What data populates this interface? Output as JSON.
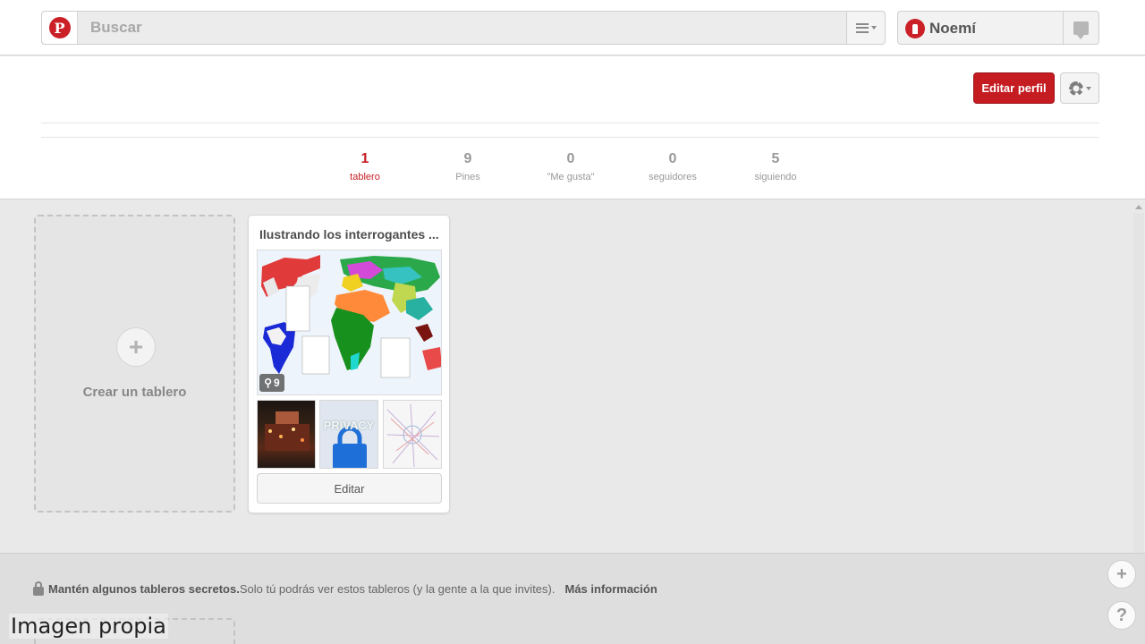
{
  "header": {
    "search_placeholder": "Buscar",
    "user_name": "Noemí"
  },
  "profile": {
    "edit_profile_label": "Editar perfil",
    "stats": [
      {
        "value": "1",
        "label": "tablero"
      },
      {
        "value": "9",
        "label": "Pines"
      },
      {
        "value": "0",
        "label": "\"Me gusta\""
      },
      {
        "value": "0",
        "label": "seguidores"
      },
      {
        "value": "5",
        "label": "siguiendo"
      }
    ]
  },
  "boards": {
    "create_label": "Crear un tablero",
    "items": [
      {
        "title": "Ilustrando los interrogantes ...",
        "pin_count": "9",
        "edit_label": "Editar",
        "thumb2_text": "PRIVACY"
      }
    ]
  },
  "secret": {
    "bold_text": "Mantén algunos tableros secretos.",
    "text": "Solo tú podrás ver estos tableros (y la gente a la que invites).",
    "more_info": "Más información"
  },
  "floating": {
    "add": "+",
    "help": "?"
  },
  "watermark": "Imagen propia",
  "colors": {
    "brand_red": "#cb2027",
    "button_red": "#c51c22"
  }
}
